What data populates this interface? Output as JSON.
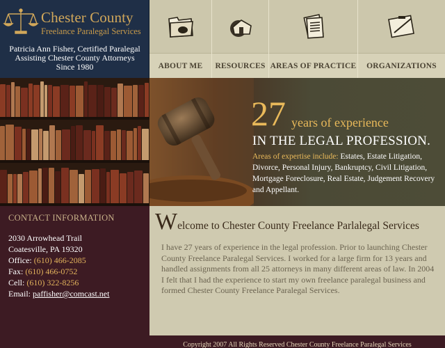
{
  "logo": {
    "title": "Chester County",
    "subtitle": "Freelance Paralegal Services"
  },
  "tagline": {
    "line1": "Patricia Ann Fisher, Certified Paralegal",
    "line2": "Assisting Chester County Attorneys",
    "line3": "Since 1980"
  },
  "nav": {
    "items": [
      {
        "label": "ABOUT ME",
        "icon": "folder-icon"
      },
      {
        "label": "RESOURCES",
        "icon": "house-icon"
      },
      {
        "label": "AREAS OF PRACTICE",
        "icon": "documents-icon"
      },
      {
        "label": "ORGANIZATIONS",
        "icon": "clipboard-icon"
      }
    ]
  },
  "hero": {
    "years": "27",
    "years_suffix": "years of experience",
    "headline": "IN THE LEGAL PROFESSION.",
    "expertise_lead": "Areas of expertise include:",
    "expertise_list": " Estates, Estate Litigation, Divorce, Personal Injury, Bankruptcy, Civil Litigation, Mortgage Foreclosure, Real Estate, Judgement Recovery and Appellant."
  },
  "contact": {
    "heading": "CONTACT INFORMATION",
    "address1": "2030 Arrowhead Trail",
    "address2": "Coatesville, PA  19320",
    "office_label": "Office:",
    "office": "(610) 466-2085",
    "fax_label": "Fax:",
    "fax": "(610) 466-0752",
    "cell_label": "Cell:",
    "cell": "(610) 322-8256",
    "email_label": "Email:",
    "email": "paffisher@comcast.net"
  },
  "main": {
    "welcome_cap": "W",
    "welcome_rest": "elcome to Chester County Freelance Parlalegal Services",
    "body": "I have 27 years of experience in the legal profession. Prior to launching Chester County Freelance Paralegal Services. I worked for a large firm for 13 years and handled assignments from all 25 attorneys in many different areas of law. In 2004 I felt that I had the experience to start my own freelance paralegal business and formed Chester County Freelance Paralegal Services."
  },
  "footer": {
    "copyright": "Copyright 2007  All Rights Reserved  Chester County Freelance Paralegal Services"
  },
  "colors": {
    "navy": "#1f2f47",
    "gold": "#e9b95a",
    "maroon": "#3d1b23",
    "khaki": "#cfcab0"
  }
}
